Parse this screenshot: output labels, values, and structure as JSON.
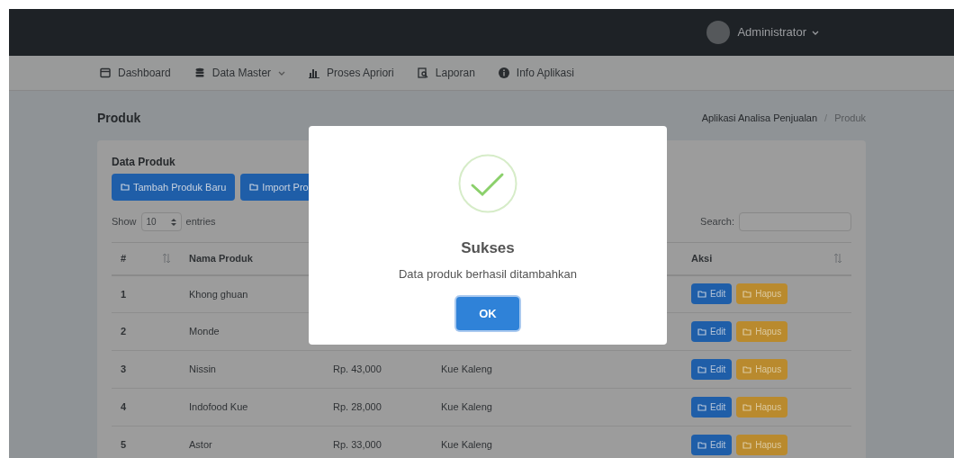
{
  "navbar": {
    "user": "Administrator"
  },
  "menu": [
    {
      "label": "Dashboard",
      "dropdown": false
    },
    {
      "label": "Data Master",
      "dropdown": true
    },
    {
      "label": "Proses Apriori",
      "dropdown": false
    },
    {
      "label": "Laporan",
      "dropdown": false
    },
    {
      "label": "Info Aplikasi",
      "dropdown": false
    }
  ],
  "page_title": "Produk",
  "breadcrumb": {
    "items": [
      "Aplikasi Analisa Penjualan",
      "Produk"
    ],
    "separator": "/"
  },
  "card": {
    "title": "Data Produk",
    "buttons": [
      "Tambah Produk Baru",
      "Import Pro"
    ],
    "show_label": "Show",
    "entries_value": "10",
    "entries_label": "entries",
    "search_label": "Search:",
    "columns": [
      {
        "label": "#",
        "sort": true
      },
      {
        "label": "Nama Produk",
        "sort": false
      },
      {
        "label": "Aksi",
        "sort": true
      }
    ],
    "rows": [
      {
        "no": "1",
        "name": "Khong ghuan",
        "actions": [
          "Edit",
          "Hapus"
        ]
      },
      {
        "no": "2",
        "name": "Monde",
        "actions": [
          "Edit",
          "Hapus"
        ]
      },
      {
        "no": "3",
        "name": "Nissin",
        "price": "Rp. 43,000",
        "category": "Kue Kaleng",
        "actions": [
          "Edit",
          "Hapus"
        ]
      },
      {
        "no": "4",
        "name": "Indofood Kue",
        "price": "Rp. 28,000",
        "category": "Kue Kaleng",
        "actions": [
          "Edit",
          "Hapus"
        ]
      },
      {
        "no": "5",
        "name": "Astor",
        "price": "Rp. 33,000",
        "category": "Kue Kaleng",
        "actions": [
          "Edit",
          "Hapus"
        ]
      }
    ]
  },
  "dialog": {
    "title": "Sukses",
    "message": "Data produk berhasil ditambahkan",
    "button": "OK"
  }
}
